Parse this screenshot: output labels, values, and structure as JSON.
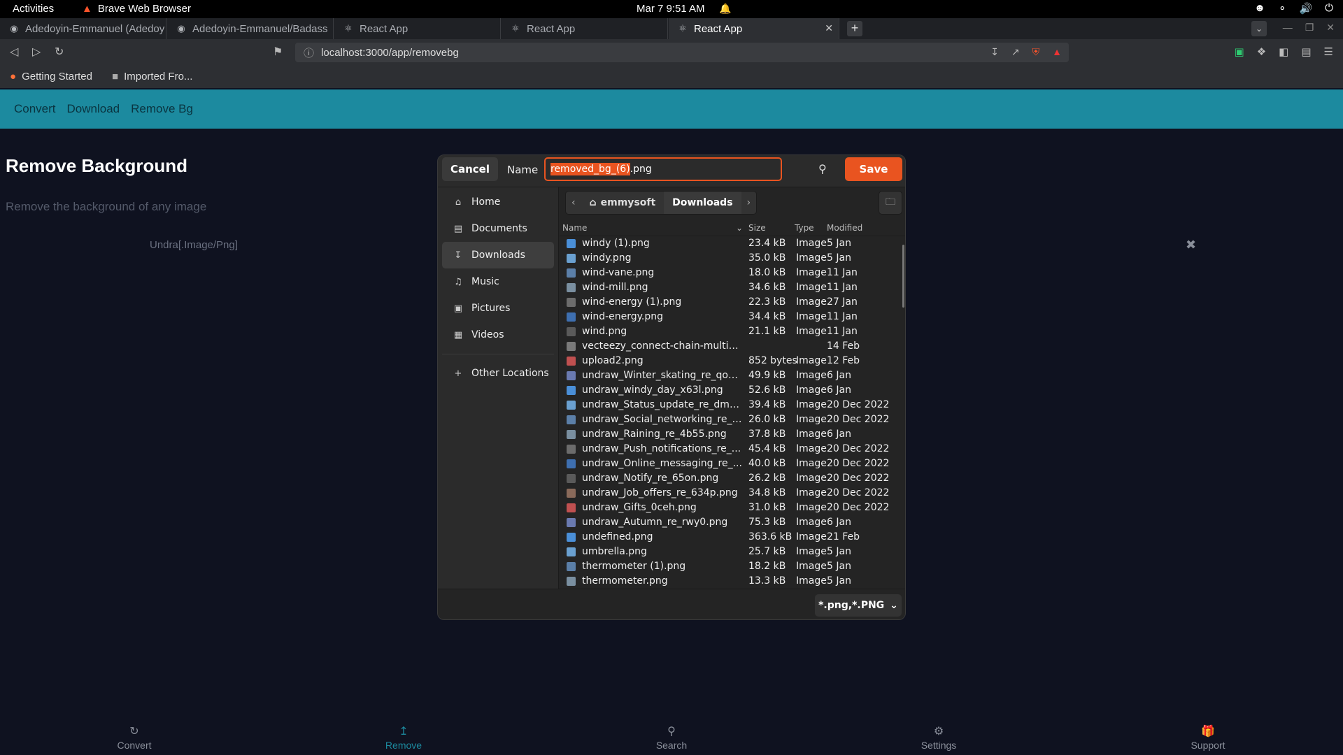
{
  "topbar": {
    "activities": "Activities",
    "app_name": "Brave Web Browser",
    "clock": "Mar 7  9:51 AM",
    "icons": [
      "accessibility-icon",
      "wifi-icon",
      "volume-icon",
      "power-icon"
    ]
  },
  "tabs": [
    {
      "label": "Adedoyin-Emmanuel (Adedoy",
      "icon": "github-icon"
    },
    {
      "label": "Adedoyin-Emmanuel/Badass",
      "icon": "github-icon"
    },
    {
      "label": "React App",
      "icon": "react-icon"
    },
    {
      "label": "React App",
      "icon": "react-icon"
    },
    {
      "label": "React App",
      "icon": "react-icon",
      "active": true
    }
  ],
  "toolbar": {
    "url": "localhost:3000/app/removebg"
  },
  "bookmarks": [
    {
      "label": "Getting Started",
      "icon": "firefox-icon"
    },
    {
      "label": "Imported Fro...",
      "icon": "folder-icon"
    }
  ],
  "app": {
    "nav": [
      "Convert",
      "Download",
      "Remove Bg"
    ],
    "title": "Remove Background",
    "subtitle": "Remove the background of any image",
    "file_type": "Undra[.Image/Png]",
    "bottom_nav": [
      {
        "label": "Convert",
        "icon": "refresh-icon"
      },
      {
        "label": "Remove",
        "icon": "upload-icon",
        "active": true
      },
      {
        "label": "Search",
        "icon": "search-icon"
      },
      {
        "label": "Settings",
        "icon": "gear-icon"
      },
      {
        "label": "Support",
        "icon": "gift-icon"
      }
    ]
  },
  "dialog": {
    "cancel": "Cancel",
    "name_label": "Name",
    "filename_selected": "removed_bg_(6)",
    "filename_ext": ".png",
    "save": "Save",
    "places": [
      {
        "label": "Home",
        "icon": "home-icon"
      },
      {
        "label": "Documents",
        "icon": "document-icon"
      },
      {
        "label": "Downloads",
        "icon": "download-icon",
        "active": true
      },
      {
        "label": "Music",
        "icon": "music-icon"
      },
      {
        "label": "Pictures",
        "icon": "picture-icon"
      },
      {
        "label": "Videos",
        "icon": "video-icon"
      }
    ],
    "other_locations": "Other Locations",
    "path": [
      "emmysoft",
      "Downloads"
    ],
    "columns": {
      "name": "Name",
      "size": "Size",
      "type": "Type",
      "modified": "Modified"
    },
    "files": [
      {
        "name": "windy (1).png",
        "size": "23.4 kB",
        "type": "Image",
        "modified": "5 Jan"
      },
      {
        "name": "windy.png",
        "size": "35.0 kB",
        "type": "Image",
        "modified": "5 Jan"
      },
      {
        "name": "wind-vane.png",
        "size": "18.0 kB",
        "type": "Image",
        "modified": "11 Jan"
      },
      {
        "name": "wind-mill.png",
        "size": "34.6 kB",
        "type": "Image",
        "modified": "11 Jan"
      },
      {
        "name": "wind-energy (1).png",
        "size": "22.3 kB",
        "type": "Image",
        "modified": "27 Jan"
      },
      {
        "name": "wind-energy.png",
        "size": "34.4 kB",
        "type": "Image",
        "modified": "11 Jan"
      },
      {
        "name": "wind.png",
        "size": "21.1 kB",
        "type": "Image",
        "modified": "11 Jan"
      },
      {
        "name": "vecteezy_connect-chain-multim...",
        "size": "",
        "type": "",
        "modified": "14 Feb",
        "folder": true
      },
      {
        "name": "upload2.png",
        "size": "852 bytes",
        "type": "Image",
        "modified": "12 Feb"
      },
      {
        "name": "undraw_Winter_skating_re_qou...",
        "size": "49.9 kB",
        "type": "Image",
        "modified": "6 Jan"
      },
      {
        "name": "undraw_windy_day_x63l.png",
        "size": "52.6 kB",
        "type": "Image",
        "modified": "6 Jan"
      },
      {
        "name": "undraw_Status_update_re_dm9...",
        "size": "39.4 kB",
        "type": "Image",
        "modified": "20 Dec 2022"
      },
      {
        "name": "undraw_Social_networking_re_i...",
        "size": "26.0 kB",
        "type": "Image",
        "modified": "20 Dec 2022"
      },
      {
        "name": "undraw_Raining_re_4b55.png",
        "size": "37.8 kB",
        "type": "Image",
        "modified": "6 Jan"
      },
      {
        "name": "undraw_Push_notifications_re_...",
        "size": "45.4 kB",
        "type": "Image",
        "modified": "20 Dec 2022"
      },
      {
        "name": "undraw_Online_messaging_re_...",
        "size": "40.0 kB",
        "type": "Image",
        "modified": "20 Dec 2022"
      },
      {
        "name": "undraw_Notify_re_65on.png",
        "size": "26.2 kB",
        "type": "Image",
        "modified": "20 Dec 2022"
      },
      {
        "name": "undraw_Job_offers_re_634p.png",
        "size": "34.8 kB",
        "type": "Image",
        "modified": "20 Dec 2022"
      },
      {
        "name": "undraw_Gifts_0ceh.png",
        "size": "31.0 kB",
        "type": "Image",
        "modified": "20 Dec 2022"
      },
      {
        "name": "undraw_Autumn_re_rwy0.png",
        "size": "75.3 kB",
        "type": "Image",
        "modified": "6 Jan"
      },
      {
        "name": "undefined.png",
        "size": "363.6 kB",
        "type": "Image",
        "modified": "21 Feb"
      },
      {
        "name": "umbrella.png",
        "size": "25.7 kB",
        "type": "Image",
        "modified": "5 Jan"
      },
      {
        "name": "thermometer (1).png",
        "size": "18.2 kB",
        "type": "Image",
        "modified": "5 Jan"
      },
      {
        "name": "thermometer.png",
        "size": "13.3 kB",
        "type": "Image",
        "modified": "5 Jan"
      }
    ],
    "filter": "*.png,*.PNG"
  },
  "colors": {
    "accent": "#e95420",
    "app_nav": "#1c8a9f",
    "page_bg": "#0f1220"
  }
}
